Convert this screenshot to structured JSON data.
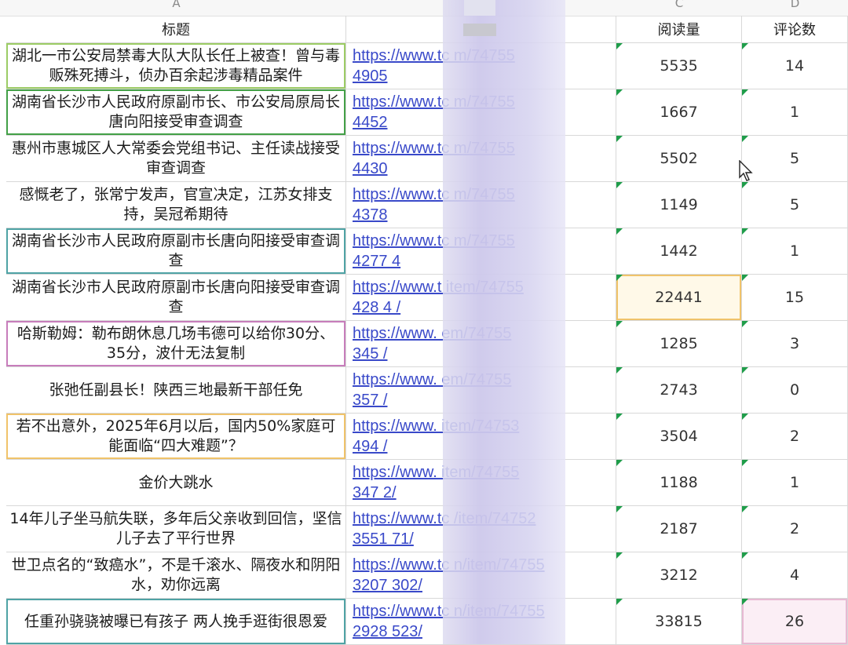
{
  "column_letters": [
    "A",
    "C",
    "D"
  ],
  "headers": {
    "title": "标题",
    "link": "",
    "reads": "阅读量",
    "comments": "评论数"
  },
  "rows": [
    {
      "title": "湖北一市公安局禁毒大队大队长任上被查！曾与毒贩殊死搏斗，侦办百余起涉毒精品案件",
      "link": "https://www.tc          m/74755\n4905",
      "reads": "5535",
      "comments": "14",
      "accent": "#9ccc65"
    },
    {
      "title": "湖南省长沙市人民政府原副市长、市公安局原局长唐向阳接受审查调查",
      "link": "https://www.tc          m/74755\n4452",
      "reads": "1667",
      "comments": "1",
      "accent": "#43a047"
    },
    {
      "title": "惠州市惠城区人大常委会党组书记、主任读战接受审查调查",
      "link": "https://www.tc          m/74755\n4430",
      "reads": "5502",
      "comments": "5",
      "accent": ""
    },
    {
      "title": "感慨老了，张常宁发声，官宣决定，江苏女排支持，吴冠希期待",
      "link": "https://www.tc          m/74755\n4378",
      "reads": "1149",
      "comments": "5",
      "accent": ""
    },
    {
      "title": "湖南省长沙市人民政府原副市长唐向阳接受审查调查",
      "link": "https://www.tc          m/74755\n4277          4",
      "reads": "1442",
      "comments": "1",
      "accent": "#4fa3a5"
    },
    {
      "title": "湖南省长沙市人民政府原副市长唐向阳接受审查调查",
      "link": "https://www.t          item/74755\n428          4   /",
      "reads": "22441",
      "comments": "15",
      "accent": ""
    },
    {
      "title": "哈斯勒姆：勒布朗休息几场韦德可以给你30分、35分，波什无法复制",
      "link": "https://www.          em/74755\n345          /",
      "reads": "1285",
      "comments": "3",
      "accent": "#c77dbb"
    },
    {
      "title": "张弛任副县长！陕西三地最新干部任免",
      "link": "https://www.          em/74755\n357          /",
      "reads": "2743",
      "comments": "0",
      "accent": ""
    },
    {
      "title": "若不出意外，2025年6月以后，国内50%家庭可能面临“四大难题”？",
      "link": "https://www.          item/74753\n494          /",
      "reads": "3504",
      "comments": "2",
      "accent": "#f0c36a"
    },
    {
      "title": "金价大跳水",
      "link": "https://www.          item/74755\n347          2/",
      "reads": "1188",
      "comments": "1",
      "accent": ""
    },
    {
      "title": "14年儿子坐马航失联，多年后父亲收到回信，坚信儿子去了平行世界",
      "link": "https://www.tc          /item/74752\n3551          71/",
      "reads": "2187",
      "comments": "2",
      "accent": ""
    },
    {
      "title": "世卫点名的“致癌水”，不是千滚水、隔夜水和阴阳水，劝你远离",
      "link": "https://www.tc          n/item/74755\n3207          302/",
      "reads": "3212",
      "comments": "4",
      "accent": ""
    },
    {
      "title": "任重孙骁骁被曝已有孩子 两人挽手逛街很恩爱",
      "link": "https://www.tc          n/item/74755\n2928          523/",
      "reads": "33815",
      "comments": "26",
      "accent": "#4fa3a5"
    }
  ]
}
